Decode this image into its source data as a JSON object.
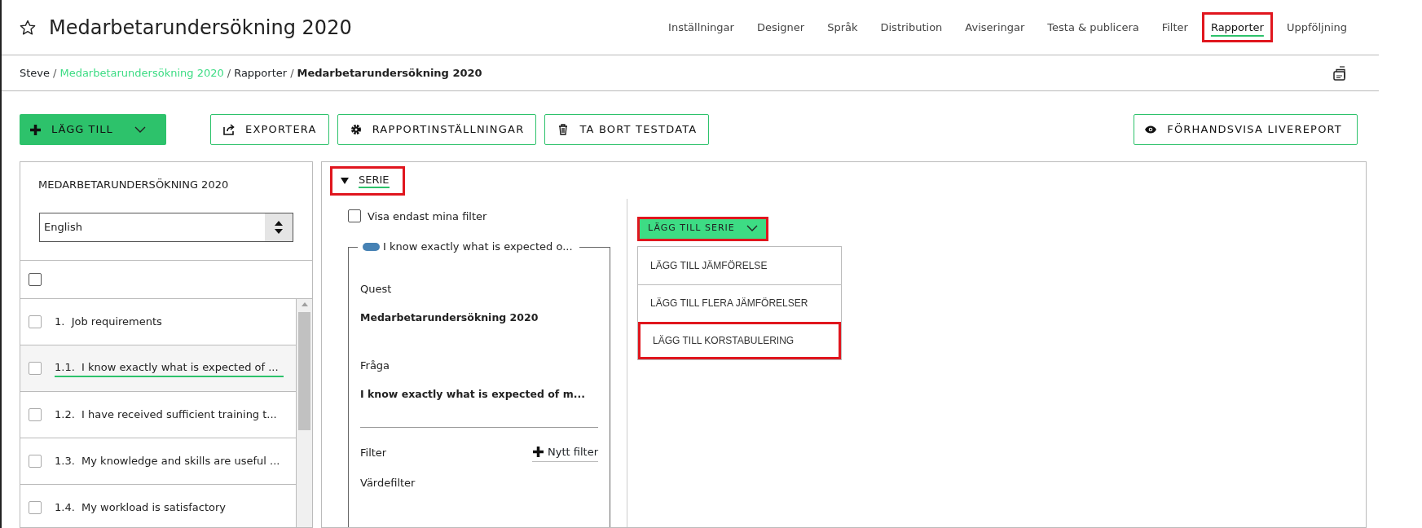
{
  "page_title": "Medarbetarundersökning 2020",
  "starred": false,
  "nav": [
    {
      "label": "Inställningar",
      "selected": false,
      "highlighted": false
    },
    {
      "label": "Designer",
      "selected": false,
      "highlighted": false
    },
    {
      "label": "Språk",
      "selected": false,
      "highlighted": false
    },
    {
      "label": "Distribution",
      "selected": false,
      "highlighted": false
    },
    {
      "label": "Aviseringar",
      "selected": false,
      "highlighted": false
    },
    {
      "label": "Testa & publicera",
      "selected": false,
      "highlighted": false
    },
    {
      "label": "Filter",
      "selected": false,
      "highlighted": false
    },
    {
      "label": "Rapporter",
      "selected": true,
      "highlighted": true
    },
    {
      "label": "Uppföljning",
      "selected": false,
      "highlighted": false
    }
  ],
  "breadcrumb": [
    {
      "label": "Steve",
      "kind": "text"
    },
    {
      "label": "/",
      "kind": "separator"
    },
    {
      "label": "Medarbetarundersökning 2020",
      "kind": "link"
    },
    {
      "label": "/",
      "kind": "separator"
    },
    {
      "label": "Rapporter",
      "kind": "text"
    },
    {
      "label": "/",
      "kind": "separator"
    },
    {
      "label": "Medarbetarundersökning 2020",
      "kind": "current"
    }
  ],
  "toolbar": {
    "add_button": "LÄGG TILL",
    "actions": [
      "EXPORTERA",
      "RAPPORTINSTÄLLNINGAR",
      "TA BORT TESTDATA"
    ],
    "preview_button": "FÖRHANDSVISA LIVEREPORT"
  },
  "sidebar": {
    "title": "MEDARBETARUNDERSÖKNING 2020",
    "language": "English",
    "select_all_checked": false,
    "items": [
      {
        "label": "1.  Job requirements",
        "checked": false,
        "selected": false
      },
      {
        "label": "1.1.  I know exactly what is expected of ...",
        "checked": false,
        "selected": true
      },
      {
        "label": "1.2.  I have received sufficient training t...",
        "checked": false,
        "selected": false
      },
      {
        "label": "1.3.  My knowledge and skills are useful ...",
        "checked": false,
        "selected": false
      },
      {
        "label": "1.4.  My workload is satisfactory",
        "checked": false,
        "selected": false
      }
    ]
  },
  "series_panel": {
    "toggle_label": "SERIE",
    "expanded": true,
    "highlighted": true,
    "only_my_filters": {
      "label": "Visa endast mina filter",
      "checked": false
    },
    "series_card": {
      "legend": "I know exactly what is expected o...",
      "fields": [
        {
          "label": "Quest",
          "value": "Medarbetarundersökning 2020"
        },
        {
          "label": "Fråga",
          "value": "I know exactly what is expected of m..."
        }
      ],
      "filter_label": "Filter",
      "new_filter": "Nytt filter",
      "value_filter_label": "Värdefilter"
    },
    "add_series": {
      "label": "LÄGG TILL SERIE",
      "expanded": true,
      "highlighted": true,
      "menu": [
        {
          "label": "LÄGG TILL JÄMFÖRELSE",
          "highlighted": false
        },
        {
          "label": "LÄGG TILL FLERA JÄMFÖRELSER",
          "highlighted": false
        },
        {
          "label": "LÄGG TILL KORSTABULERING",
          "highlighted": true
        }
      ]
    }
  }
}
